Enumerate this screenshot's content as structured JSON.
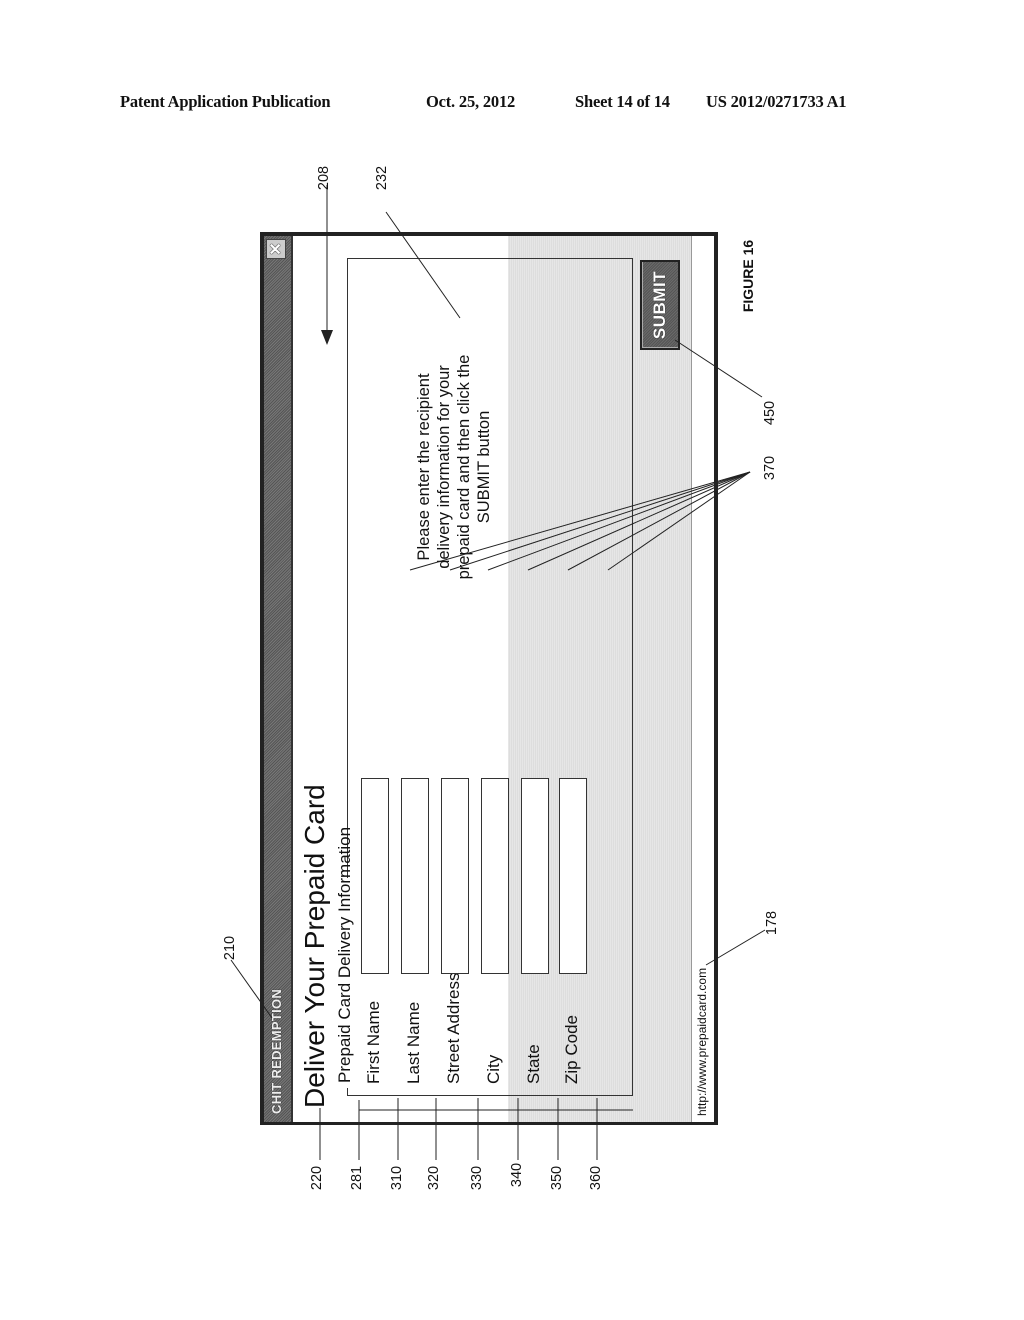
{
  "header": {
    "publication": "Patent Application Publication",
    "date": "Oct. 25, 2012",
    "sheet": "Sheet 14 of 14",
    "number": "US 2012/0271733 A1"
  },
  "dialog": {
    "title": "CHIT REDEMPTION",
    "close_icon": "close-x-icon",
    "heading": "Deliver Your Prepaid Card",
    "section_legend": "Prepaid Card Delivery Information",
    "fields": [
      {
        "label": "First Name",
        "value": ""
      },
      {
        "label": "Last Name",
        "value": ""
      },
      {
        "label": "Street Address",
        "value": ""
      },
      {
        "label": "City",
        "value": ""
      },
      {
        "label": "State",
        "value": ""
      },
      {
        "label": "Zip Code",
        "value": ""
      }
    ],
    "instructions": "Please enter the recipient delivery information for your prepaid card and then click the SUBMIT button",
    "submit_label": "SUBMIT",
    "status_url": "http://www.prepaidcard.com"
  },
  "reference_numerals": {
    "window": "208",
    "title_bar": "210",
    "heading": "220",
    "instructions": "232",
    "legend": "281",
    "first_name": "310",
    "last_name": "320",
    "street_address": "330",
    "city": "340",
    "state": "350",
    "zip_code": "360",
    "input_fields": "370",
    "submit": "450",
    "url": "178"
  },
  "figure_label": "FIGURE 16"
}
